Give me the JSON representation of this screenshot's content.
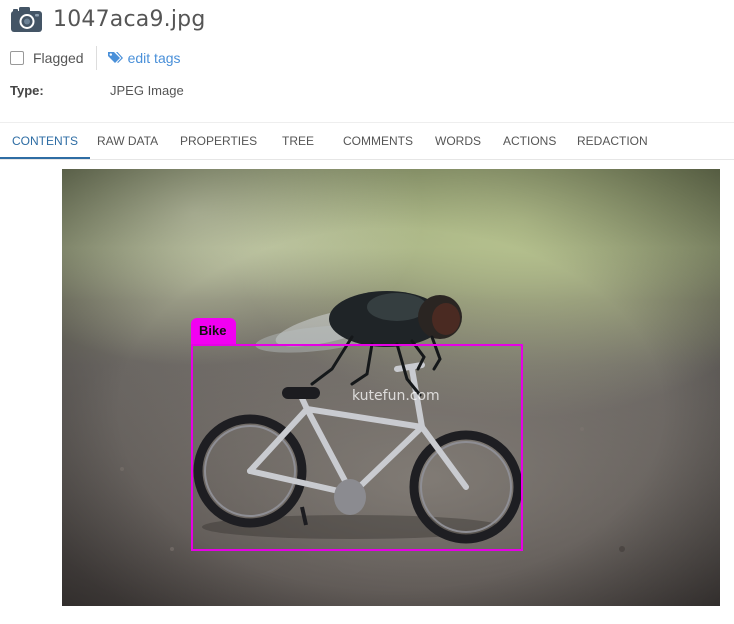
{
  "file": {
    "title": "1047aca9.jpg",
    "icon": "camera-icon"
  },
  "meta": {
    "flagged_label": "Flagged",
    "flagged_checked": false,
    "edit_tags_label": "edit tags"
  },
  "type": {
    "label": "Type:",
    "value": "JPEG Image"
  },
  "tabs": [
    {
      "label": "CONTENTS",
      "active": true
    },
    {
      "label": "RAW DATA",
      "active": false
    },
    {
      "label": "PROPERTIES",
      "active": false
    },
    {
      "label": "TREE",
      "active": false
    },
    {
      "label": "COMMENTS",
      "active": false
    },
    {
      "label": "WORDS",
      "active": false
    },
    {
      "label": "ACTIONS",
      "active": false
    },
    {
      "label": "REDACTION",
      "active": false
    }
  ],
  "image": {
    "watermark": "kutefun.com",
    "detections": [
      {
        "label": "Bike",
        "color": "#f200f2"
      }
    ]
  },
  "colors": {
    "accent": "#2e6da4",
    "link": "#4a90d9",
    "bbox": "#e600e6"
  }
}
